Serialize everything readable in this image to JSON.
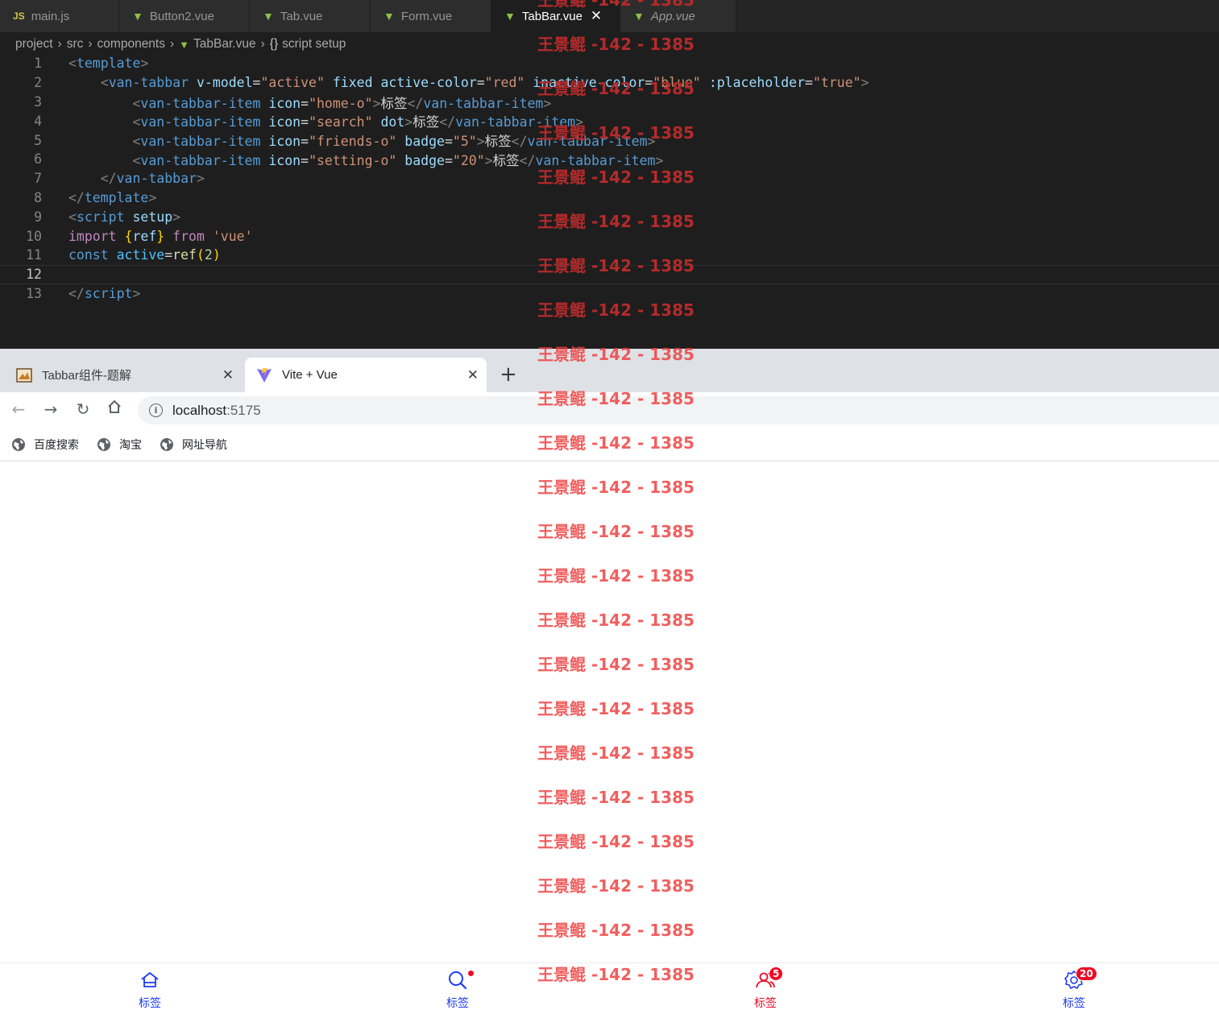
{
  "editor": {
    "tabs": [
      {
        "label": "main.js",
        "icon": "js-icon",
        "active": false
      },
      {
        "label": "Button2.vue",
        "icon": "vue-icon",
        "active": false
      },
      {
        "label": "Tab.vue",
        "icon": "vue-icon",
        "active": false
      },
      {
        "label": "Form.vue",
        "icon": "vue-icon",
        "active": false
      },
      {
        "label": "TabBar.vue",
        "icon": "vue-icon",
        "active": true
      },
      {
        "label": "App.vue",
        "icon": "vue-icon",
        "active": false
      }
    ],
    "breadcrumb": [
      "project",
      "src",
      "components",
      "TabBar.vue",
      "{}",
      "script setup"
    ],
    "current_line": 12,
    "lines": [
      {
        "n": "1"
      },
      {
        "n": "2"
      },
      {
        "n": "3"
      },
      {
        "n": "4"
      },
      {
        "n": "5"
      },
      {
        "n": "6"
      },
      {
        "n": "7"
      },
      {
        "n": "8"
      },
      {
        "n": "9"
      },
      {
        "n": "10"
      },
      {
        "n": "11"
      },
      {
        "n": "12"
      },
      {
        "n": "13"
      }
    ],
    "code": {
      "l1_open": "<",
      "l1_tag": "template",
      "l1_close": ">",
      "l2_tag": "van-tabbar",
      "l2_a1": "v-model",
      "l2_v1": "\"active\"",
      "l2_a2": "fixed",
      "l2_a3": "active-color",
      "l2_v3": "\"red\"",
      "l2_a4": "inactive-color",
      "l2_v4": "\"blue\"",
      "l2_a5": ":placeholder",
      "l2_v5": "\"true\"",
      "item_tag": "van-tabbar-item",
      "icon_attr": "icon",
      "badge_attr": "badge",
      "dot_attr": "dot",
      "l3_v": "\"home-o\"",
      "l4_v": "\"search\"",
      "l5_v": "\"friends-o\"",
      "l5_b": "\"5\"",
      "l6_v": "\"setting-o\"",
      "l6_b": "\"20\"",
      "label": "标签",
      "l7_tag": "van-tabbar",
      "l8_tag": "template",
      "l9_tag": "script",
      "l9_attr": "setup",
      "l10_kw": "import",
      "l10_ob": "{",
      "l10_id": "ref",
      "l10_cb": "}",
      "l10_from": "from",
      "l10_str": "'vue'",
      "l11_kw": "const",
      "l11_var": "active",
      "l11_eq": "=",
      "l11_fn": "ref",
      "l11_op": "(",
      "l11_num": "2",
      "l11_cp": ")",
      "l13_tag": "script"
    }
  },
  "browser": {
    "tabs": [
      {
        "title": "Tabbar组件-题解",
        "active": false
      },
      {
        "title": "Vite + Vue",
        "active": true
      }
    ],
    "new_tab": "+",
    "url_host": "localhost",
    "url_port": ":5175",
    "bookmarks": [
      "百度搜索",
      "淘宝",
      "网址导航"
    ]
  },
  "tabbar": {
    "active_color": "#ee0a24",
    "inactive_color": "#1e3cf0",
    "items": [
      {
        "label": "标签",
        "icon": "home-o",
        "badge": ""
      },
      {
        "label": "标签",
        "icon": "search",
        "badge": ""
      },
      {
        "label": "标签",
        "icon": "friends-o",
        "badge": "5"
      },
      {
        "label": "标签",
        "icon": "setting-o",
        "badge": "20"
      }
    ]
  },
  "watermark": "王景鲲 -142 - 1385"
}
